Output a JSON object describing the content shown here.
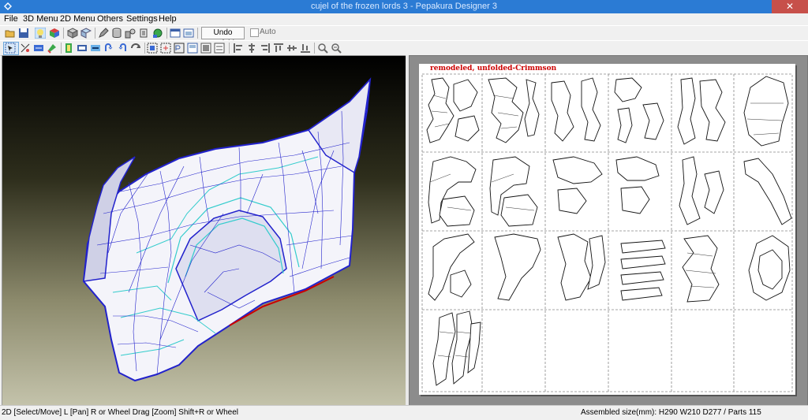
{
  "window": {
    "title": "cujel of the frozen lords 3 - Pepakura Designer 3",
    "close_glyph": "✕"
  },
  "menu": [
    "File",
    "3D Menu",
    "2D Menu",
    "Others",
    "Settings",
    "Help"
  ],
  "toolbar1": {
    "undo_label": "Undo Unfold",
    "auto_label": "Auto"
  },
  "toolbar1_icons": [
    "open-icon",
    "save-icon",
    "lightbulb-icon",
    "texture-cube-icon",
    "box-icon",
    "box-alt-icon",
    "pencil-icon",
    "cylinder-icon",
    "shapes-icon",
    "layers-icon",
    "sphere-icon",
    "view-icon",
    "window-icon"
  ],
  "toolbar2_icons": [
    "select-icon",
    "split-icon",
    "join-icon",
    "move-icon",
    "rotate-icon",
    "flip-icon",
    "line-icon",
    "fold-icon",
    "crease-icon",
    "text-icon",
    "image-icon",
    "print-icon",
    "paste-icon",
    "print-alt-icon",
    "grid-icon",
    "align-icon",
    "align-center-icon",
    "align-right-icon",
    "align-top-icon",
    "align-mid-icon",
    "align-bottom-icon",
    "zoom-in-icon",
    "zoom-out-icon"
  ],
  "sheet": {
    "label": "remodeled, unfolded-Crimmson"
  },
  "status": {
    "left": "2D [Select/Move] L [Pan] R or Wheel Drag [Zoom] Shift+R or Wheel",
    "right": "Assembled size(mm): H290 W210 D277 / Parts 115"
  },
  "colors": {
    "titlebar": "#2b7bd4",
    "close": "#c7504a",
    "mesh_edge": "#1a1acc",
    "inner_edge": "#33cccc",
    "red_edge": "#cc0000"
  }
}
